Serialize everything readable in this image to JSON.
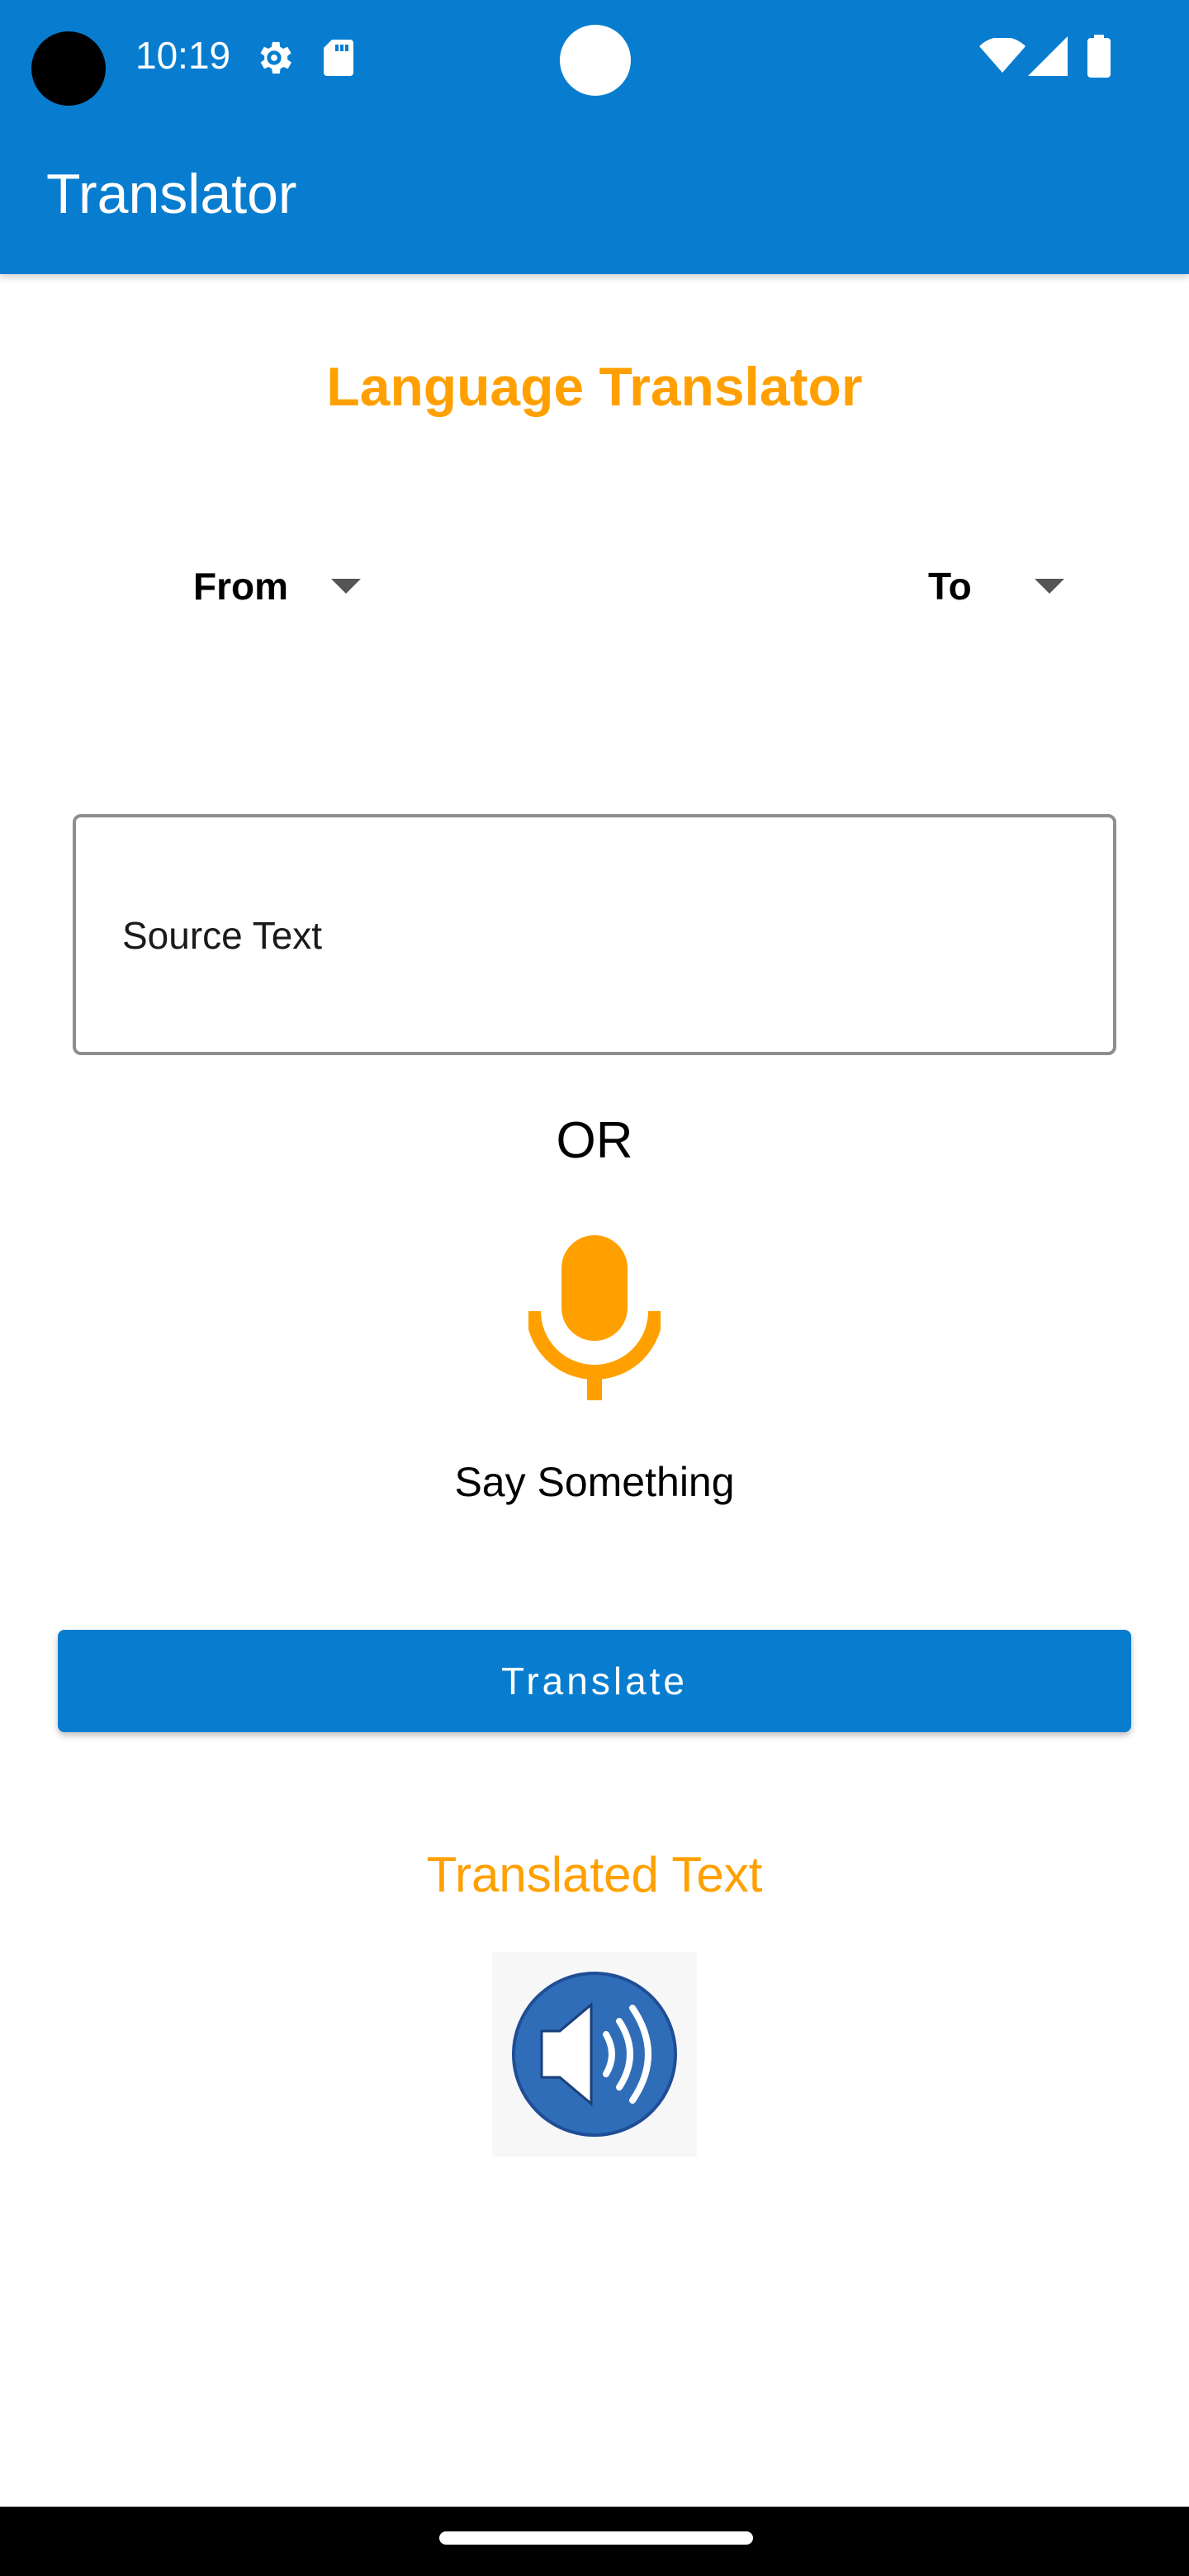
{
  "status_bar": {
    "time": "10:19",
    "icons": [
      "gear-icon",
      "sd-card-icon",
      "wifi-icon",
      "signal-icon",
      "battery-icon"
    ]
  },
  "app_bar": {
    "title": "Translator",
    "color": "#087DD0"
  },
  "main": {
    "heading": "Language Translator",
    "from_label": "From",
    "to_label": "To",
    "source_placeholder": "Source Text",
    "or_label": "OR",
    "mic_icon": "microphone-icon",
    "say_label": "Say Something",
    "translate_label": "Translate",
    "translated_label": "Translated Text",
    "speaker_icon": "speaker-icon"
  },
  "colors": {
    "primary": "#087DD0",
    "accent": "#FFA000"
  }
}
